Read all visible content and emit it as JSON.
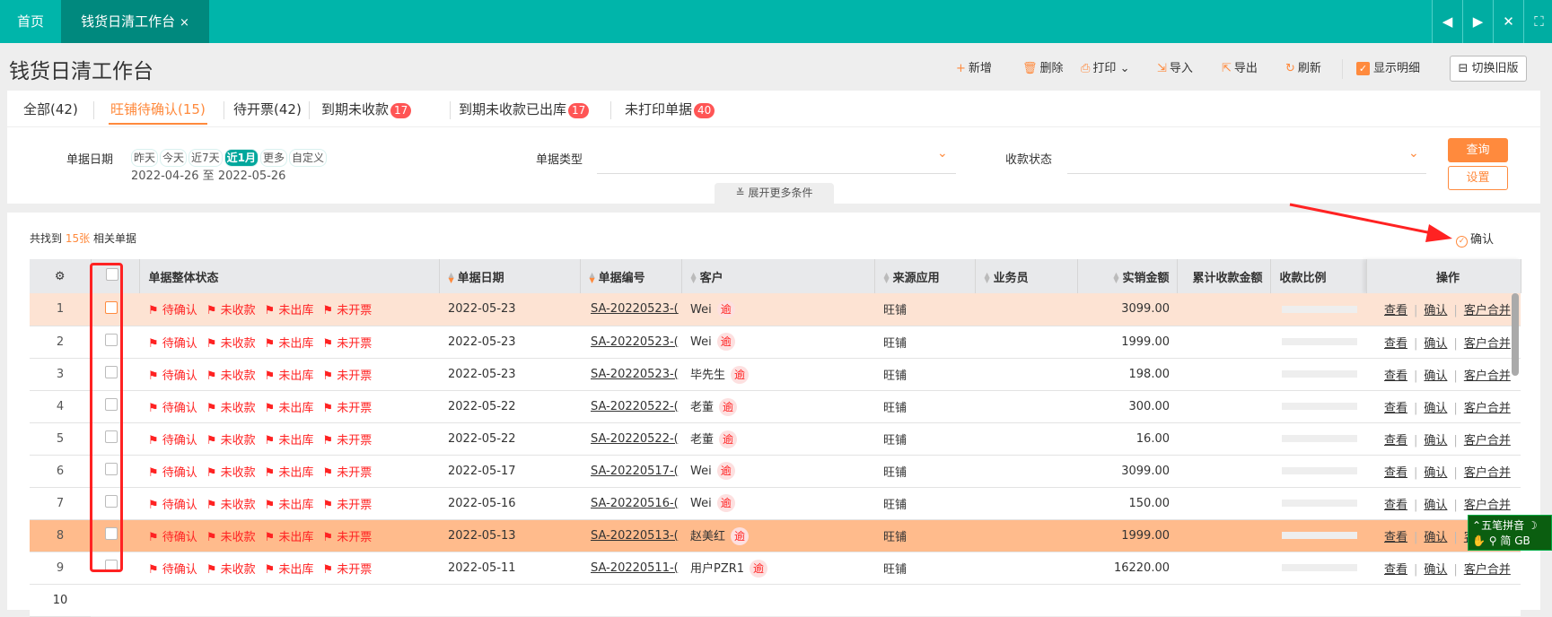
{
  "tabs": {
    "home": "首页",
    "active": "钱货日清工作台",
    "close": "×"
  },
  "window_controls": [
    "◀",
    "▶",
    "✕",
    "⛶"
  ],
  "page_title": "钱货日清工作台",
  "toolbar": {
    "add": "新增",
    "delete": "删除",
    "print": "打印",
    "import": "导入",
    "export": "导出",
    "refresh": "刷新",
    "show_detail": "显示明细",
    "show_detail_checked": true,
    "switch_old": "切换旧版"
  },
  "status_tabs": [
    {
      "label": "全部(42)"
    },
    {
      "label": "旺铺待确认(15)",
      "active": true
    },
    {
      "label": "待开票(42)"
    },
    {
      "label": "到期未收款",
      "badge": "17"
    },
    {
      "label": "到期未收款已出库",
      "badge": "17"
    },
    {
      "label": "未打印单据",
      "badge": "40"
    }
  ],
  "filters": {
    "date_label": "单据日期",
    "date_chips": [
      "昨天",
      "今天",
      "近7天",
      "近1月",
      "更多",
      "自定义"
    ],
    "date_selected": "近1月",
    "date_range": "2022-04-26 至 2022-05-26",
    "type_label": "单据类型",
    "type_value": "",
    "pay_label": "收款状态",
    "pay_value": "",
    "query": "查询",
    "settings": "设置",
    "expand": "展开更多条件"
  },
  "summary": {
    "prefix": "共找到",
    "count": "15张",
    "suffix": "相关单据"
  },
  "confirm_button": "确认",
  "columns": [
    "",
    "",
    "单据整体状态",
    "单据日期",
    "单据编号",
    "客户",
    "来源应用",
    "业务员",
    "实销金额",
    "累计收款金额",
    "收款比例",
    "操作"
  ],
  "status_flags": [
    "待确认",
    "未收款",
    "未出库",
    "未开票"
  ],
  "overdue_tag": "逾",
  "actions": [
    "查看",
    "确认",
    "客户合并"
  ],
  "rows": [
    {
      "no": "1",
      "date": "2022-05-23",
      "code": "SA-20220523-(",
      "customer": "Wei",
      "source": "旺铺",
      "sales": "",
      "amount": "3099.00",
      "cum": "",
      "highlight": "light"
    },
    {
      "no": "2",
      "date": "2022-05-23",
      "code": "SA-20220523-(",
      "customer": "Wei",
      "source": "旺铺",
      "sales": "",
      "amount": "1999.00",
      "cum": ""
    },
    {
      "no": "3",
      "date": "2022-05-23",
      "code": "SA-20220523-(",
      "customer": "毕先生",
      "source": "旺铺",
      "sales": "",
      "amount": "198.00",
      "cum": ""
    },
    {
      "no": "4",
      "date": "2022-05-22",
      "code": "SA-20220522-(",
      "customer": "老董",
      "source": "旺铺",
      "sales": "",
      "amount": "300.00",
      "cum": ""
    },
    {
      "no": "5",
      "date": "2022-05-22",
      "code": "SA-20220522-(",
      "customer": "老董",
      "source": "旺铺",
      "sales": "",
      "amount": "16.00",
      "cum": ""
    },
    {
      "no": "6",
      "date": "2022-05-17",
      "code": "SA-20220517-(",
      "customer": "Wei",
      "source": "旺铺",
      "sales": "",
      "amount": "3099.00",
      "cum": ""
    },
    {
      "no": "7",
      "date": "2022-05-16",
      "code": "SA-20220516-(",
      "customer": "Wei",
      "source": "旺铺",
      "sales": "",
      "amount": "150.00",
      "cum": ""
    },
    {
      "no": "8",
      "date": "2022-05-13",
      "code": "SA-20220513-(",
      "customer": "赵美红",
      "source": "旺铺",
      "sales": "",
      "amount": "1999.00",
      "cum": "",
      "highlight": "strong"
    },
    {
      "no": "9",
      "date": "2022-05-11",
      "code": "SA-20220511-(",
      "customer": "用户PZR1",
      "source": "旺铺",
      "sales": "",
      "amount": "16220.00",
      "cum": ""
    },
    {
      "no": "10",
      "partial": true
    }
  ],
  "ime": {
    "line1": "五笔拼音",
    "line2a": "简",
    "line2b": "GB"
  },
  "colors": {
    "teal": "#00b5aa",
    "orange": "#ff8a3d",
    "row_light": "#fde3d3",
    "row_strong": "#ffbb8c",
    "flag": "#ff2222"
  }
}
